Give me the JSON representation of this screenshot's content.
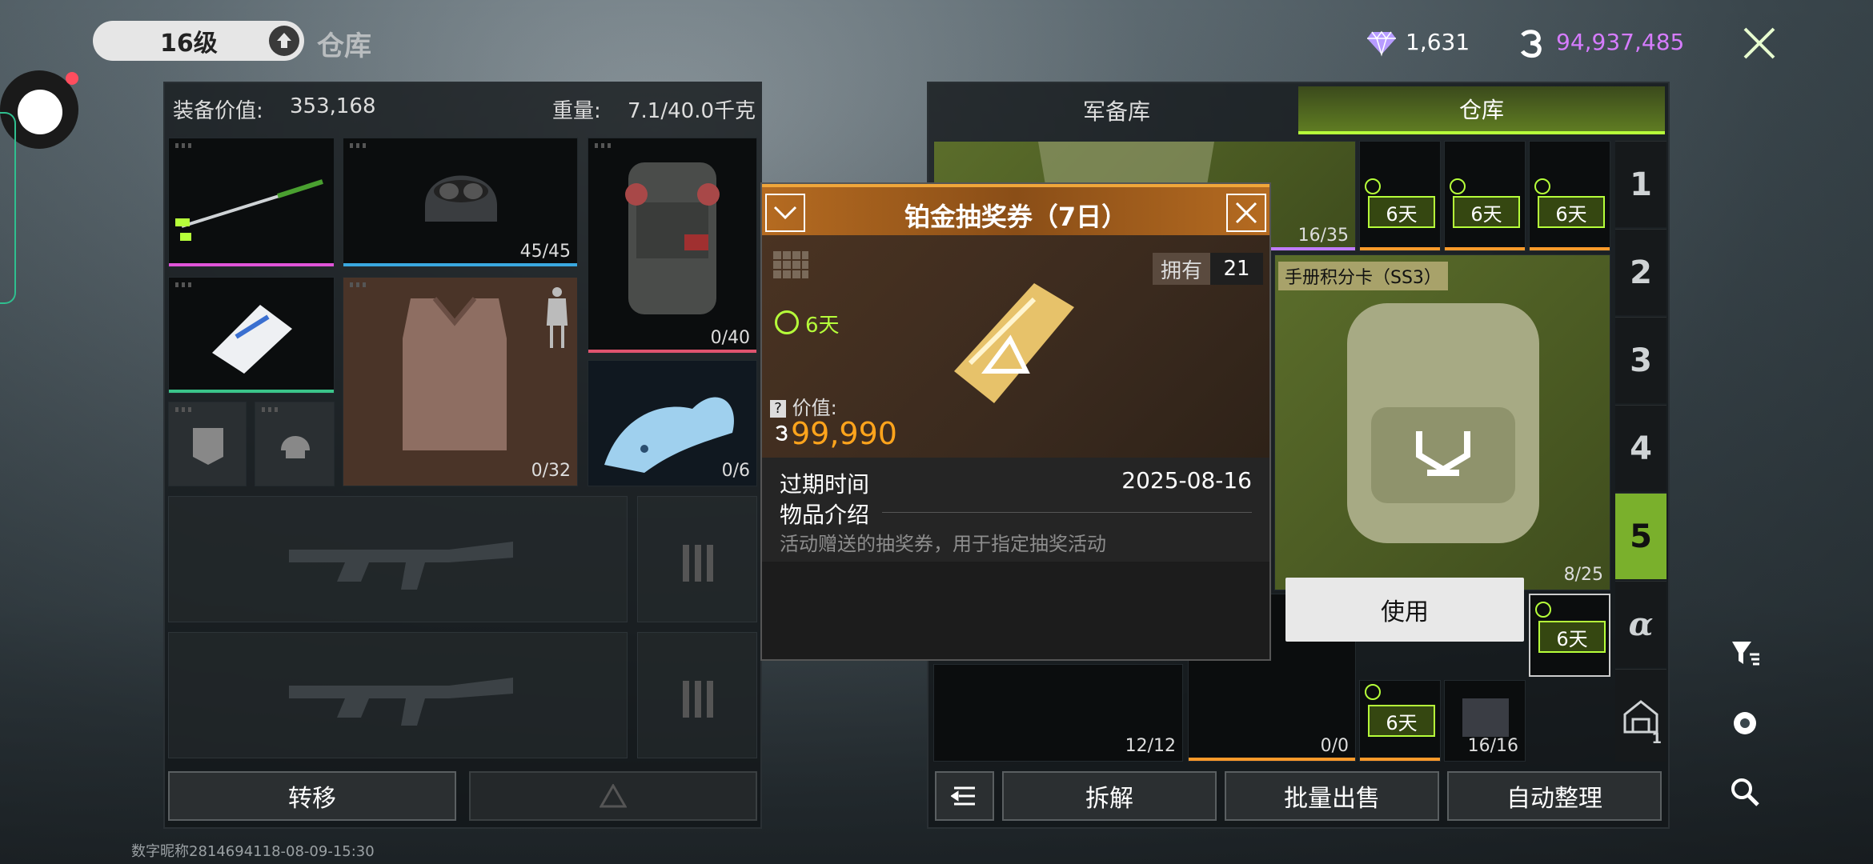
{
  "header": {
    "level": "16级",
    "title": "仓库",
    "gems": "1,631",
    "coins": "94,937,485"
  },
  "left_panel": {
    "equip_value_label": "装备价值:",
    "equip_value": "353,168",
    "weight_label": "重量:",
    "weight_value": "7.1/40.0千克",
    "helmet_durability": "45/45",
    "backpack_capacity": "0/40",
    "armor_durability": "0/32",
    "dragon_count": "0/6",
    "transfer_button": "转移"
  },
  "right_panel": {
    "tabs": [
      "军备库",
      "仓库"
    ],
    "pages": [
      "1",
      "2",
      "3",
      "4",
      "5",
      "α"
    ],
    "card_label": "手册积分卡（SS3）",
    "counts": {
      "top_item": "16/35",
      "backpack": "8/25",
      "vest": "12/12",
      "pack2": "0/0",
      "book": "16/16"
    },
    "timer_label": "6天",
    "buttons": {
      "dismantle": "拆解",
      "bulk_sell": "批量出售",
      "auto_sort": "自动整理"
    },
    "warehouse_badge": "1"
  },
  "popup": {
    "title": "铂金抽奖券（7日）",
    "own_label": "拥有",
    "own_count": "21",
    "timer": "6天",
    "value_label": "价值:",
    "value": "99,990",
    "expire_label": "过期时间",
    "expire_date": "2025-08-16",
    "desc_label": "物品介绍",
    "desc_text": "活动赠送的抽奖券，用于指定抽奖活动"
  },
  "context_menu": {
    "use": "使用"
  },
  "footer": {
    "watermark": "数字昵称2814694118-08-09-15:30"
  },
  "colors": {
    "accent_green": "#b6ff3a",
    "active_page": "#7ab02c",
    "coin_purple": "#d67cff",
    "value_orange": "#ffa41c",
    "popup_header": "#b56b21"
  }
}
